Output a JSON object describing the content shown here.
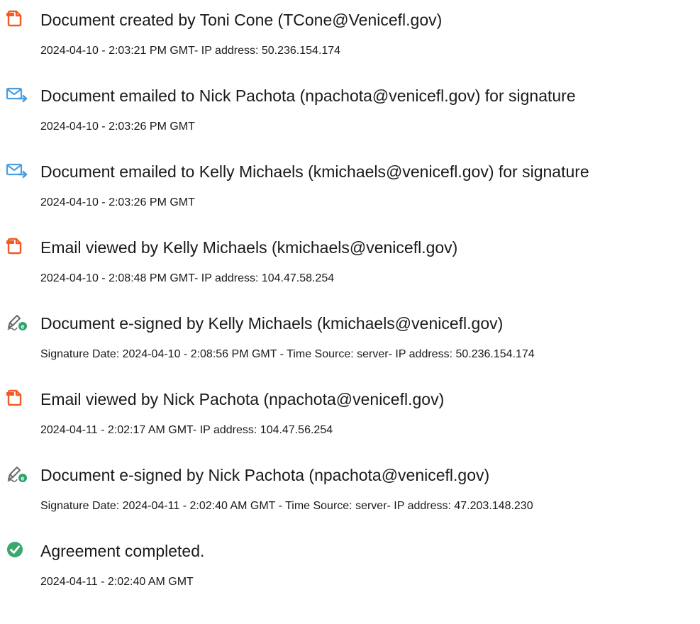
{
  "colors": {
    "doc_icon": "#f15a24",
    "email_icon": "#4a9ee0",
    "sign_icon_pen": "#6a6a6a",
    "sign_icon_badge": "#2fa36b",
    "complete_icon": "#3aa76d",
    "text": "#1a1a1a"
  },
  "events": [
    {
      "icon": "document-icon",
      "title": "Document created by Toni Cone (TCone@Venicefl.gov)",
      "detail": "2024-04-10 - 2:03:21 PM GMT- IP address: 50.236.154.174"
    },
    {
      "icon": "email-send-icon",
      "title": "Document emailed to Nick Pachota (npachota@venicefl.gov) for signature",
      "detail": "2024-04-10 - 2:03:26 PM GMT"
    },
    {
      "icon": "email-send-icon",
      "title": "Document emailed to Kelly Michaels (kmichaels@venicefl.gov) for signature",
      "detail": "2024-04-10 - 2:03:26 PM GMT"
    },
    {
      "icon": "document-icon",
      "title": "Email viewed by Kelly Michaels (kmichaels@venicefl.gov)",
      "detail": "2024-04-10 - 2:08:48 PM GMT- IP address: 104.47.58.254"
    },
    {
      "icon": "esign-icon",
      "title": "Document e-signed by Kelly Michaels (kmichaels@venicefl.gov)",
      "detail": "Signature Date: 2024-04-10 - 2:08:56 PM GMT - Time Source: server- IP address: 50.236.154.174"
    },
    {
      "icon": "document-icon",
      "title": "Email viewed by Nick Pachota (npachota@venicefl.gov)",
      "detail": "2024-04-11 - 2:02:17 AM GMT- IP address: 104.47.56.254"
    },
    {
      "icon": "esign-icon",
      "title": "Document e-signed by Nick Pachota (npachota@venicefl.gov)",
      "detail": "Signature Date: 2024-04-11 - 2:02:40 AM GMT - Time Source: server- IP address: 47.203.148.230"
    },
    {
      "icon": "checkmark-circle-icon",
      "title": "Agreement completed.",
      "detail": "2024-04-11 - 2:02:40 AM GMT"
    }
  ]
}
